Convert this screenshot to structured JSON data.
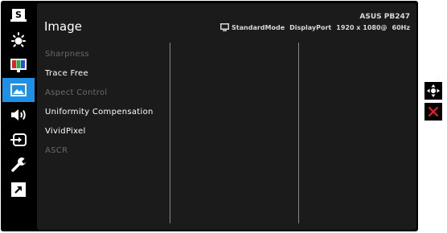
{
  "header": {
    "title": "Image",
    "model": "ASUS PB247",
    "mode": "StandardMode",
    "input": "DisplayPort",
    "resolution": "1920 x 1080@",
    "refresh": "60Hz"
  },
  "sidebar": {
    "items": [
      {
        "icon": "splendid-icon",
        "label": "S",
        "selected": false
      },
      {
        "icon": "brightness-icon",
        "selected": false
      },
      {
        "icon": "color-icon",
        "selected": false
      },
      {
        "icon": "image-icon",
        "selected": true
      },
      {
        "icon": "sound-icon",
        "selected": false
      },
      {
        "icon": "input-select-icon",
        "selected": false
      },
      {
        "icon": "system-setup-icon",
        "selected": false
      },
      {
        "icon": "shortcut-icon",
        "selected": false
      }
    ]
  },
  "menu": {
    "items": [
      {
        "label": "Sharpness",
        "enabled": false
      },
      {
        "label": "Trace Free",
        "enabled": true
      },
      {
        "label": "Aspect Control",
        "enabled": false
      },
      {
        "label": "Uniformity Compensation",
        "enabled": true
      },
      {
        "label": "VividPixel",
        "enabled": true
      },
      {
        "label": "ASCR",
        "enabled": false
      }
    ]
  },
  "controls": {
    "items": [
      {
        "icon": "navigate-icon"
      },
      {
        "icon": "close-icon",
        "color": "#e8202a"
      }
    ]
  },
  "colors": {
    "selected": "#1e90e6",
    "panel": "#1b1b1b",
    "text": "#ffffff",
    "disabled_text": "#6a6a6a"
  }
}
